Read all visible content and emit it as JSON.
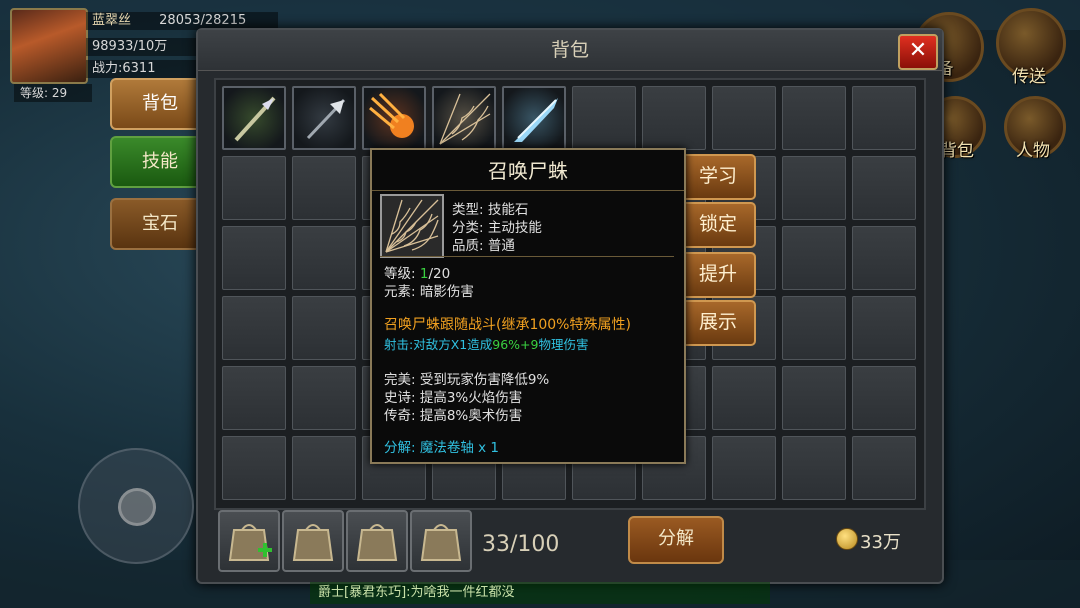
{
  "player": {
    "name": "蓝翠丝",
    "hp": "28053/28215",
    "exp": "98933/10万",
    "power": "战力:6311",
    "level": "等级: 29"
  },
  "top_right": {
    "transfer_label": "传送",
    "bag_label": "背包",
    "character_label": "人物",
    "partial_label": "备"
  },
  "panel": {
    "title": "背包",
    "close_label": "✕"
  },
  "side_tabs": {
    "bag": "背包",
    "skill": "技能",
    "gem": "宝石"
  },
  "items": [
    {
      "icon": "spear-skill-icon",
      "color": "#6aa040"
    },
    {
      "icon": "arrow-skill-icon",
      "color": "#607080"
    },
    {
      "icon": "fire-meteor-skill-icon",
      "color": "#e05a18"
    },
    {
      "icon": "spider-web-skill-icon",
      "color": "#c8b088"
    },
    {
      "icon": "ice-blade-skill-icon",
      "color": "#70c0e8"
    }
  ],
  "actions": {
    "learn": "学习",
    "lock": "锁定",
    "upgrade": "提升",
    "show": "展示"
  },
  "tooltip": {
    "name": "召唤尸蛛",
    "type": "类型: 技能石",
    "category": "分类: 主动技能",
    "quality": "品质: 普通",
    "level_label": "等级: ",
    "level_current": "1",
    "level_max": "/20",
    "element": "元素: 暗影伤害",
    "effect_title": "召唤尸蛛跟随战斗(继承100%特殊属性)",
    "shoot_label": "射击:",
    "shoot_text_a": "对敌方X1造成",
    "shoot_percent": "96%+9",
    "shoot_text_b": "物理伤害",
    "perfect": "完美: 受到玩家伤害降低9%",
    "epic": "史诗: 提高3%火焰伤害",
    "legend": "传奇: 提高8%奥术伤害",
    "decompose_label": "分解: ",
    "decompose_item": "魔法卷轴",
    "decompose_qty": " x 1"
  },
  "bottom": {
    "capacity": "33/100",
    "decompose_button": "分解",
    "currency": "33万"
  },
  "chat": {
    "text": "爵士[暴君东巧]:为啥我一件红都没"
  },
  "colors": {
    "accent": "#d09850",
    "quality_green": "#3ad040",
    "highlight_orange": "#f0a020",
    "highlight_cyan": "#30c0e0"
  }
}
